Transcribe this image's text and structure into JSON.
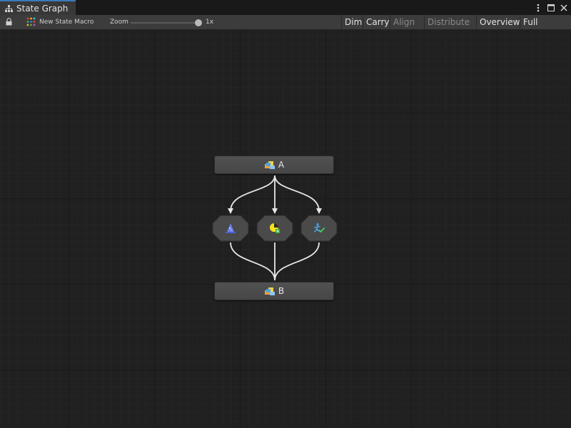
{
  "window": {
    "tab_title": "State Graph"
  },
  "toolbar": {
    "macro_name": "New State Macro",
    "zoom_label": "Zoom",
    "zoom_value": "1x",
    "zoom_level": 1.0,
    "buttons": {
      "dim": "Dim",
      "carry": "Carry",
      "align": "Align",
      "distribute": "Distribute",
      "overview": "Overview",
      "full_screen": "Full Screen"
    }
  },
  "graph": {
    "states": [
      {
        "label": "A",
        "icon": "state-macro-icon"
      },
      {
        "label": "B",
        "icon": "state-macro-icon"
      }
    ],
    "transitions": [
      {
        "icon": "wizard-hat-icon"
      },
      {
        "icon": "yellow-event-icon"
      },
      {
        "icon": "running-check-icon"
      }
    ]
  },
  "colors": {
    "canvas_bg": "#202020",
    "node_bg": "#4c4c4c",
    "edge": "#e8e8e8",
    "tab_accent": "#3a79bb",
    "toolbar_bg": "#3c3c3c"
  }
}
